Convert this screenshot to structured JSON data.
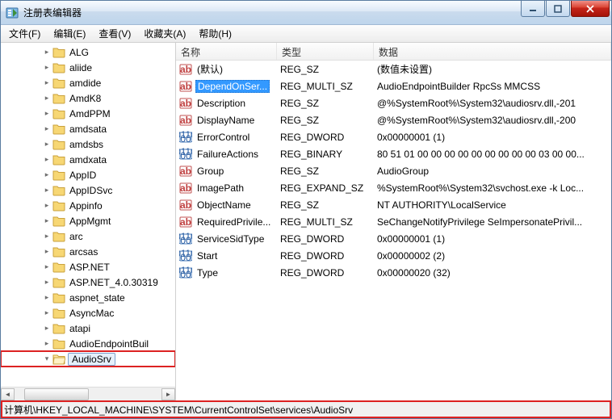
{
  "window": {
    "title": "注册表编辑器"
  },
  "menus": {
    "file": "文件(F)",
    "edit": "编辑(E)",
    "view": "查看(V)",
    "favorites": "收藏夹(A)",
    "help": "帮助(H)"
  },
  "tree": {
    "items": [
      {
        "label": "ALG"
      },
      {
        "label": "aliide"
      },
      {
        "label": "amdide"
      },
      {
        "label": "AmdK8"
      },
      {
        "label": "AmdPPM"
      },
      {
        "label": "amdsata"
      },
      {
        "label": "amdsbs"
      },
      {
        "label": "amdxata"
      },
      {
        "label": "AppID"
      },
      {
        "label": "AppIDSvc"
      },
      {
        "label": "Appinfo"
      },
      {
        "label": "AppMgmt"
      },
      {
        "label": "arc"
      },
      {
        "label": "arcsas"
      },
      {
        "label": "ASP.NET"
      },
      {
        "label": "ASP.NET_4.0.30319"
      },
      {
        "label": "aspnet_state"
      },
      {
        "label": "AsyncMac"
      },
      {
        "label": "atapi"
      },
      {
        "label": "AudioEndpointBuil"
      },
      {
        "label": "AudioSrv",
        "selected": true,
        "highlighted": true,
        "expanded": true
      }
    ]
  },
  "columns": {
    "name": "名称",
    "type": "类型",
    "data": "数据"
  },
  "values": [
    {
      "icon": "str",
      "name": "(默认)",
      "type": "REG_SZ",
      "data": "(数值未设置)"
    },
    {
      "icon": "str",
      "name": "DependOnSer...",
      "type": "REG_MULTI_SZ",
      "data": "AudioEndpointBuilder RpcSs MMCSS",
      "selected": true
    },
    {
      "icon": "str",
      "name": "Description",
      "type": "REG_SZ",
      "data": "@%SystemRoot%\\System32\\audiosrv.dll,-201"
    },
    {
      "icon": "str",
      "name": "DisplayName",
      "type": "REG_SZ",
      "data": "@%SystemRoot%\\System32\\audiosrv.dll,-200"
    },
    {
      "icon": "bin",
      "name": "ErrorControl",
      "type": "REG_DWORD",
      "data": "0x00000001 (1)"
    },
    {
      "icon": "bin",
      "name": "FailureActions",
      "type": "REG_BINARY",
      "data": "80 51 01 00 00 00 00 00 00 00 00 00 03 00 00..."
    },
    {
      "icon": "str",
      "name": "Group",
      "type": "REG_SZ",
      "data": "AudioGroup"
    },
    {
      "icon": "str",
      "name": "ImagePath",
      "type": "REG_EXPAND_SZ",
      "data": "%SystemRoot%\\System32\\svchost.exe -k Loc..."
    },
    {
      "icon": "str",
      "name": "ObjectName",
      "type": "REG_SZ",
      "data": "NT AUTHORITY\\LocalService"
    },
    {
      "icon": "str",
      "name": "RequiredPrivile...",
      "type": "REG_MULTI_SZ",
      "data": "SeChangeNotifyPrivilege SeImpersonatePrivil..."
    },
    {
      "icon": "bin",
      "name": "ServiceSidType",
      "type": "REG_DWORD",
      "data": "0x00000001 (1)"
    },
    {
      "icon": "bin",
      "name": "Start",
      "type": "REG_DWORD",
      "data": "0x00000002 (2)"
    },
    {
      "icon": "bin",
      "name": "Type",
      "type": "REG_DWORD",
      "data": "0x00000020 (32)"
    }
  ],
  "status": {
    "path": "计算机\\HKEY_LOCAL_MACHINE\\SYSTEM\\CurrentControlSet\\services\\AudioSrv"
  }
}
